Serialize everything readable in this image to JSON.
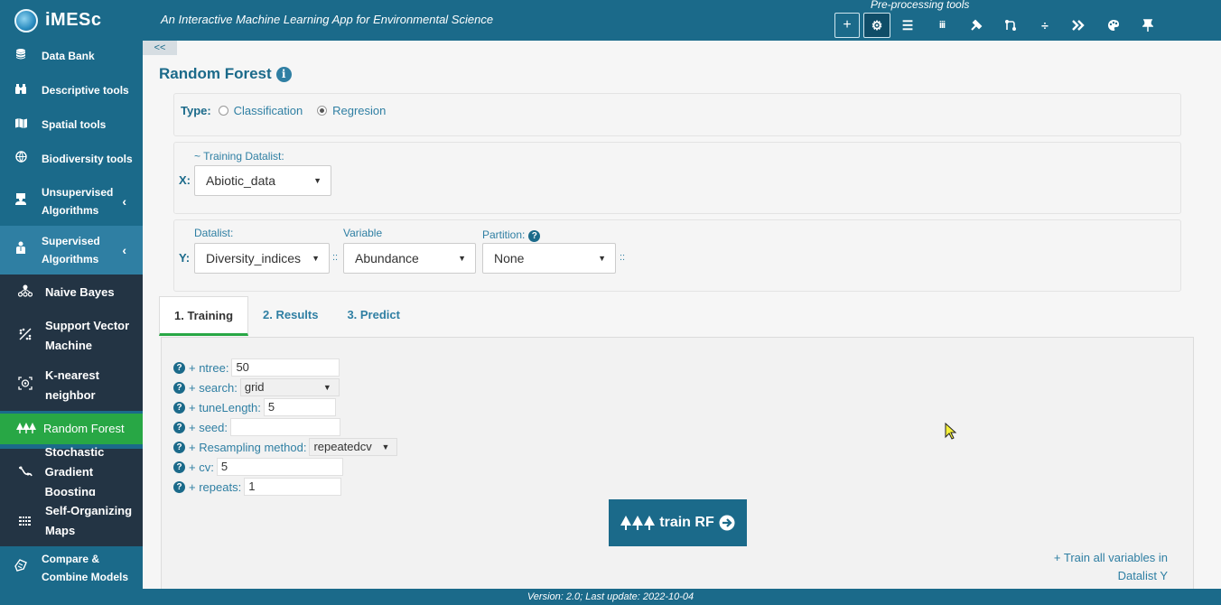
{
  "app": {
    "title": "iMESc",
    "tagline": "An Interactive Machine Learning App for Environmental Science",
    "preprocessing_label": "Pre-processing tools",
    "footer": "Version: 2.0; Last update: 2022-10-04"
  },
  "toolbar": {
    "tools": [
      {
        "icon": "plus-icon",
        "glyph": "+"
      },
      {
        "icon": "gear-icon",
        "glyph": "⚙"
      },
      {
        "icon": "list-icon",
        "glyph": "☰"
      },
      {
        "icon": "columns-icon",
        "glyph": "⁞⁞⁞"
      },
      {
        "icon": "hammer-icon",
        "glyph": "⚒"
      },
      {
        "icon": "code-branch-icon",
        "glyph": "⎇"
      },
      {
        "icon": "divide-icon",
        "glyph": "÷"
      },
      {
        "icon": "arrow-merge-icon",
        "glyph": "➤"
      },
      {
        "icon": "palette-icon",
        "glyph": "🎨"
      },
      {
        "icon": "pin-icon",
        "glyph": "📌"
      }
    ]
  },
  "sidebar": {
    "items": [
      {
        "label": "Data Bank",
        "icon": "database-icon"
      },
      {
        "label": "Descriptive tools",
        "icon": "binoculars-icon"
      },
      {
        "label": "Spatial tools",
        "icon": "map-icon"
      },
      {
        "label": "Biodiversity tools",
        "icon": "globe-icon"
      },
      {
        "label": "Unsupervised Algorithms",
        "icon": "user-group-icon"
      },
      {
        "label": "Supervised Algorithms",
        "icon": "user-teacher-icon"
      },
      {
        "label": "Compare & Combine Models",
        "icon": "hands-icon"
      }
    ],
    "sub_items": [
      {
        "label": "Naive Bayes"
      },
      {
        "label": "Support Vector Machine"
      },
      {
        "label": "K-nearest neighbor"
      },
      {
        "label": "Random Forest"
      },
      {
        "label": "Stochastic Gradient Boosting"
      },
      {
        "label": "Self-Organizing Maps"
      }
    ],
    "collapse_label": "<<"
  },
  "main": {
    "title": "Random Forest",
    "type": {
      "label": "Type:",
      "options": [
        "Classification",
        "Regresion"
      ],
      "selected": "Regresion"
    },
    "x": {
      "axis": "X:",
      "caption": "~ Training Datalist:",
      "value": "Abiotic_data"
    },
    "y": {
      "axis": "Y:",
      "datalist_label": "Datalist:",
      "datalist_value": "Diversity_indices",
      "variable_label": "Variable",
      "variable_value": "Abundance",
      "partition_label": "Partition:",
      "partition_value": "None",
      "separator": "::"
    },
    "tabs": [
      "1. Training",
      "2. Results",
      "3. Predict"
    ],
    "params": [
      {
        "label": "+ ntree:",
        "value": "50"
      },
      {
        "label": "+ search:",
        "value": "grid"
      },
      {
        "label": "+ tuneLength:",
        "value": "5"
      },
      {
        "label": "+ seed:",
        "value": ""
      },
      {
        "label": "+ Resampling method:",
        "value": "repeatedcv"
      },
      {
        "label": "+ cv:",
        "value": "5"
      },
      {
        "label": "+ repeats:",
        "value": "1"
      }
    ],
    "train_button": "train RF",
    "train_all": "+ Train all variables in Datalist Y"
  },
  "colors": {
    "primary": "#1b6a8a",
    "accent_green": "#28a745",
    "dark_sub": "#233444"
  }
}
